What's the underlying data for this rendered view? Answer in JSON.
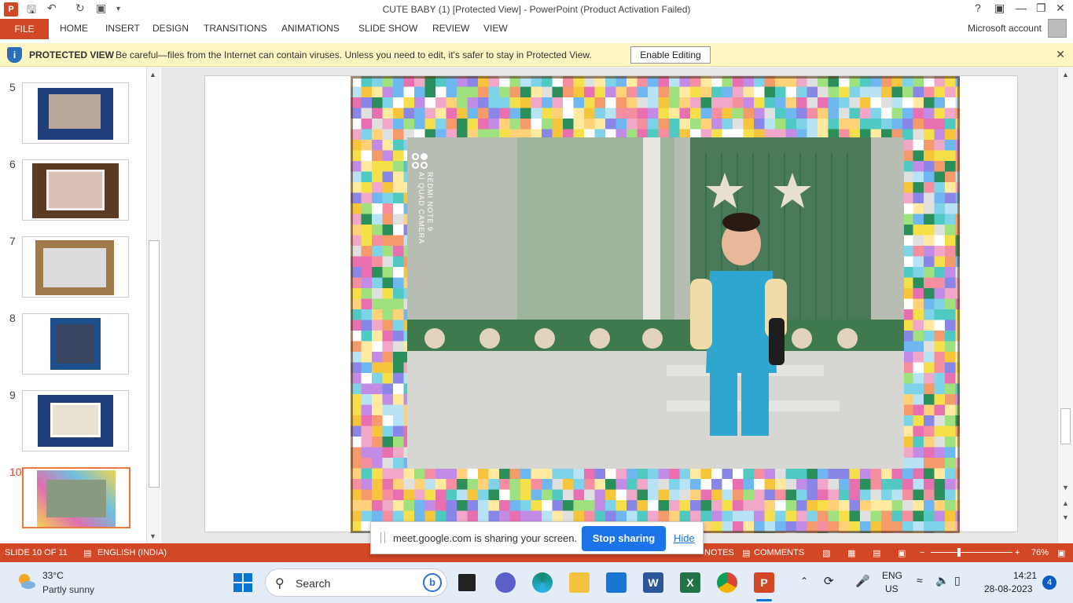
{
  "window": {
    "title": "CUTE BABY (1) [Protected View] - PowerPoint (Product Activation Failed)",
    "app_icon_label": "P"
  },
  "ribbon": {
    "file": "FILE",
    "tabs": [
      "HOME",
      "INSERT",
      "DESIGN",
      "TRANSITIONS",
      "ANIMATIONS",
      "SLIDE SHOW",
      "REVIEW",
      "VIEW"
    ],
    "account": "Microsoft account"
  },
  "protected_view": {
    "title": "PROTECTED VIEW",
    "message": "Be careful—files from the Internet can contain viruses. Unless you need to edit, it's safer to stay in Protected View.",
    "button": "Enable Editing"
  },
  "thumbnails": [
    {
      "number": "5",
      "bg": "#1f3f7a"
    },
    {
      "number": "6",
      "bg": "#5a3a22"
    },
    {
      "number": "7",
      "bg": "#a07a4a"
    },
    {
      "number": "8",
      "bg": "#1d4f8a"
    },
    {
      "number": "9",
      "bg": "#1f3f7a"
    },
    {
      "number": "10",
      "bg": "#d8c060",
      "active": true
    }
  ],
  "photo": {
    "watermark_line1": "REDMI NOTE 9",
    "watermark_line2": "AI QUAD CAMERA"
  },
  "status": {
    "slide": "SLIDE 10 OF 11",
    "language": "ENGLISH (INDIA)",
    "notes": "NOTES",
    "comments": "COMMENTS",
    "zoom": "76%"
  },
  "share": {
    "message": "meet.google.com is sharing your screen.",
    "stop": "Stop sharing",
    "hide": "Hide"
  },
  "taskbar": {
    "temperature": "33°C",
    "condition": "Partly sunny",
    "search": "Search",
    "lang1": "ENG",
    "lang2": "US",
    "time": "14:21",
    "date": "28-08-2023",
    "badge": "4"
  }
}
